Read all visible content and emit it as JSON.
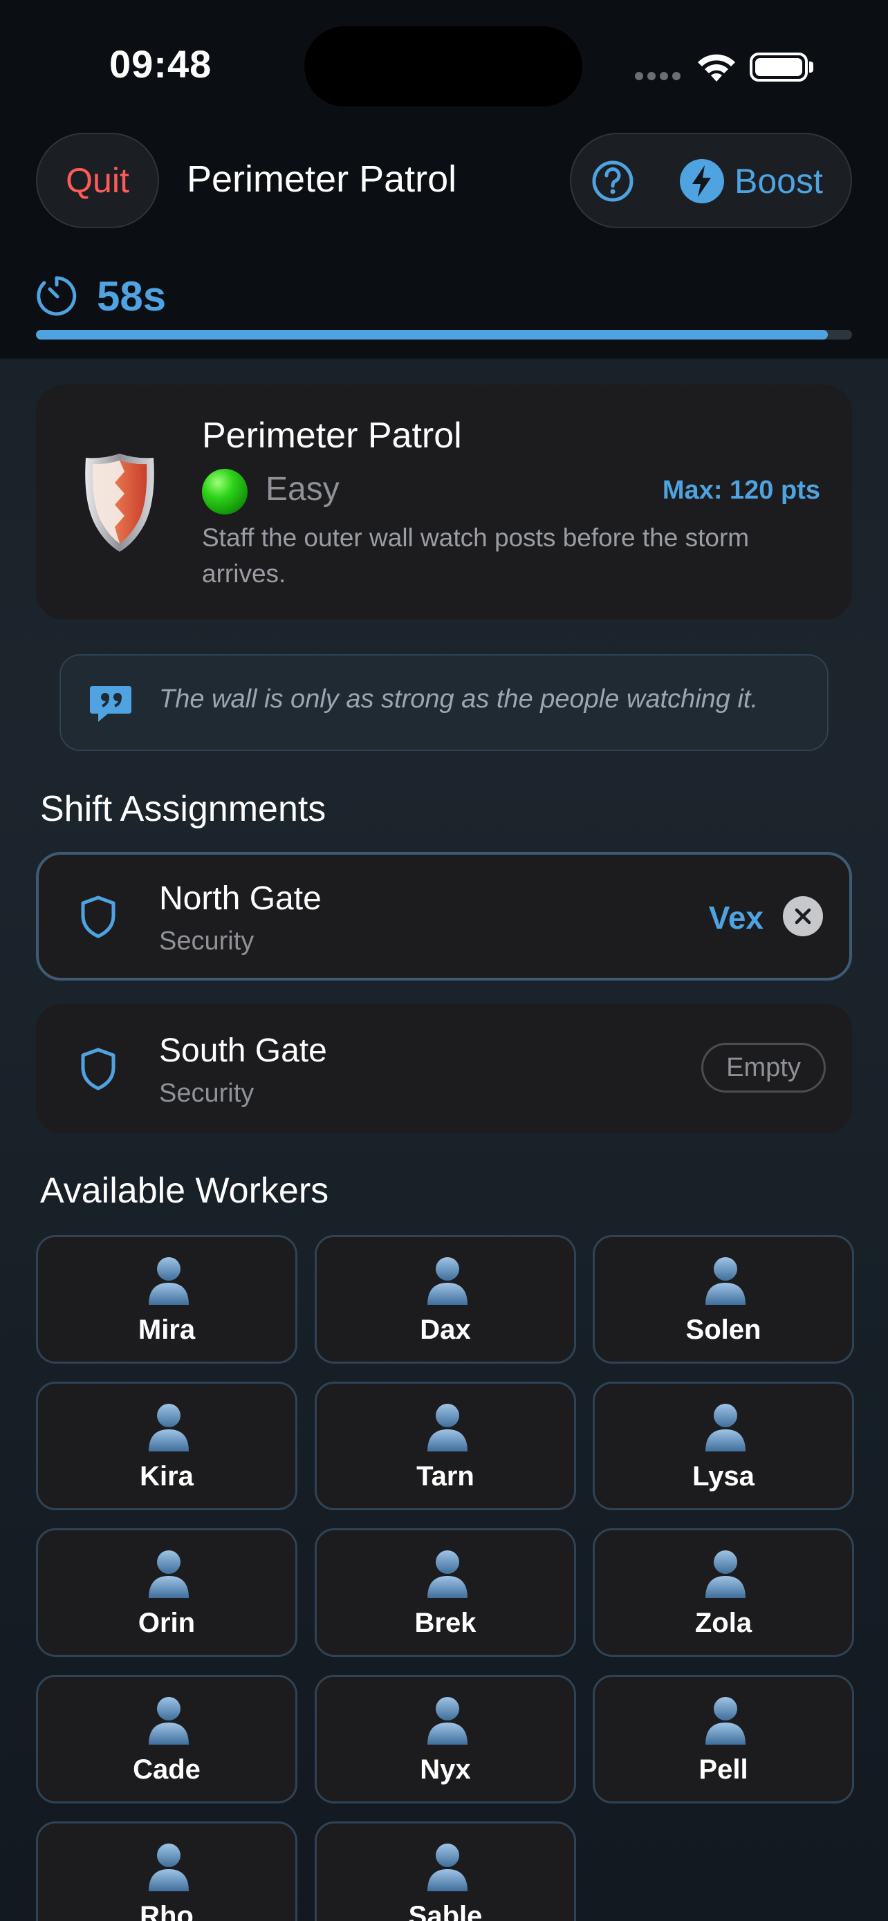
{
  "status_bar": {
    "time": "09:48"
  },
  "top_bar": {
    "quit_label": "Quit",
    "title": "Perimeter Patrol",
    "help_icon": "question-circle-icon",
    "boost_icon": "lightning-bolt-icon",
    "boost_label": "Boost"
  },
  "timer": {
    "label": "58s",
    "progress_fraction": 0.97
  },
  "mission": {
    "title": "Perimeter Patrol",
    "difficulty": "Easy",
    "max_points": "Max: 120 pts",
    "description": "Staff the outer wall watch posts before the storm arrives."
  },
  "quote": {
    "text": "The wall is only as strong as the people watching it."
  },
  "shift_section": {
    "title": "Shift Assignments",
    "shifts": [
      {
        "name": "North Gate",
        "role": "Security",
        "assigned": "Vex"
      },
      {
        "name": "South Gate",
        "role": "Security",
        "status": "Empty"
      }
    ]
  },
  "workers_section": {
    "title": "Available Workers",
    "workers": [
      "Mira",
      "Dax",
      "Solen",
      "Kira",
      "Tarn",
      "Lysa",
      "Orin",
      "Brek",
      "Zola",
      "Cade",
      "Nyx",
      "Pell",
      "Rho",
      "Sable"
    ]
  },
  "colors": {
    "accent": "#4ea3e0",
    "quit": "#ff5a5a",
    "card": "#1c1c1e",
    "easy": "#2ed31a"
  }
}
